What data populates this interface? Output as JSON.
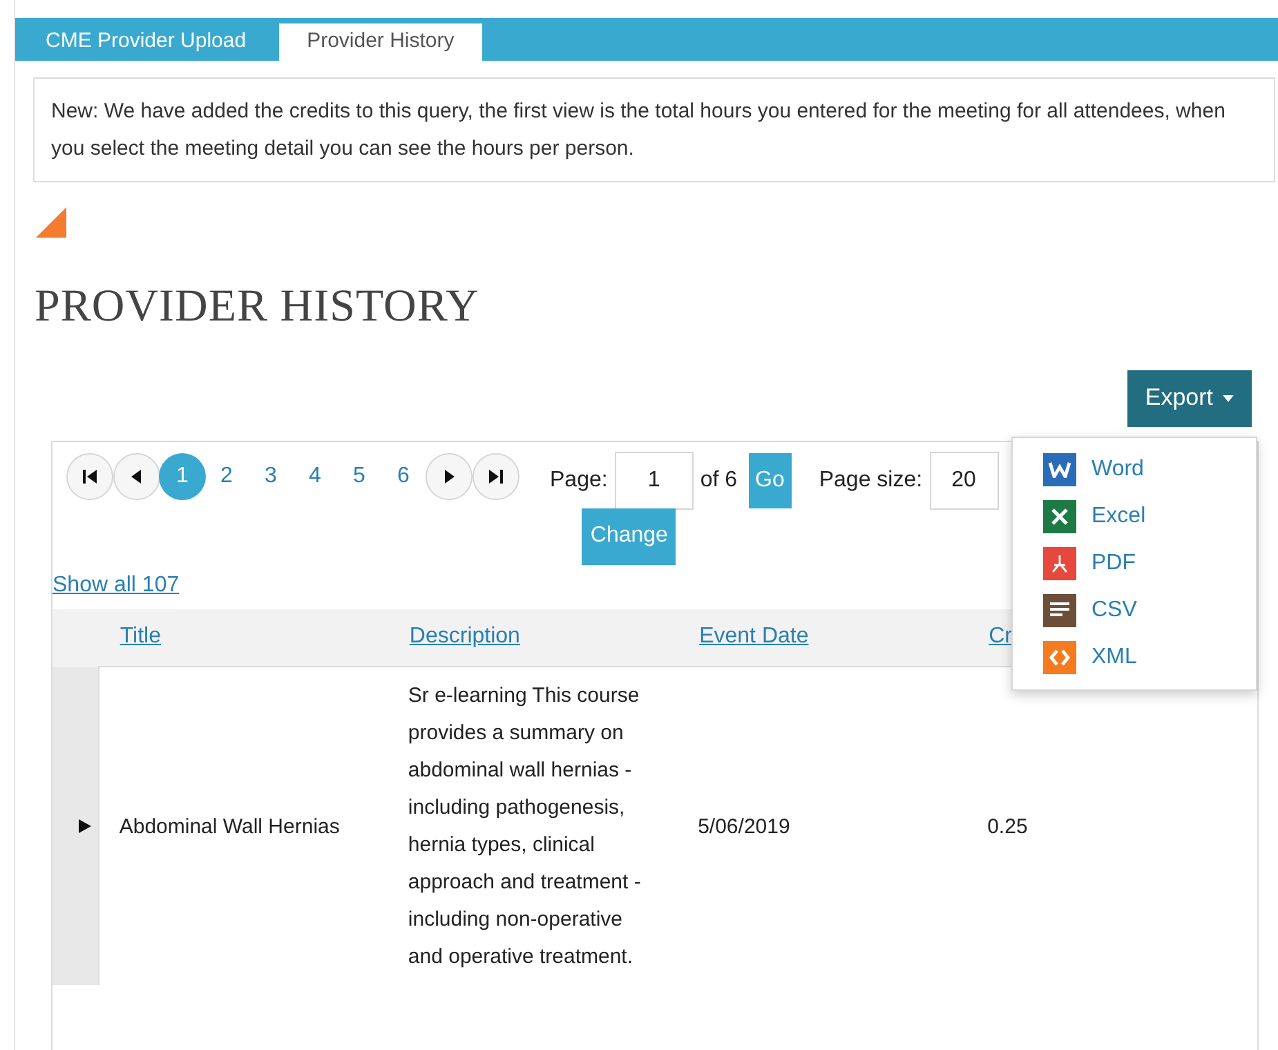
{
  "tabs": [
    {
      "label": "CME Provider Upload",
      "selected": false
    },
    {
      "label": "Provider History",
      "selected": true
    }
  ],
  "notice": "New: We have added the credits to this query, the first view is the total hours you entered for the meeting for all attendees, when you select the meeting detail you can see the hours per person.",
  "heading": "PROVIDER HISTORY",
  "export": {
    "label": "Export",
    "expanded": true,
    "items": [
      {
        "kind": "word",
        "label": "Word"
      },
      {
        "kind": "excel",
        "label": "Excel"
      },
      {
        "kind": "pdf",
        "label": "PDF"
      },
      {
        "kind": "csv",
        "label": "CSV"
      },
      {
        "kind": "xml",
        "label": "XML"
      }
    ]
  },
  "pager": {
    "pages": [
      {
        "label": "1",
        "selected": true
      },
      {
        "label": "2",
        "selected": false
      },
      {
        "label": "3",
        "selected": false
      },
      {
        "label": "4",
        "selected": false
      },
      {
        "label": "5",
        "selected": false
      },
      {
        "label": "6",
        "selected": false
      }
    ],
    "page_label": "Page:",
    "page_value": "1",
    "of": "of 6",
    "go": "Go",
    "size_label": "Page size:",
    "size_value": "20",
    "change": "Change"
  },
  "show_all": "Show all 107",
  "table": {
    "columns": [
      "Title",
      "Description",
      "Event Date",
      "Cr"
    ],
    "rows": [
      {
        "expanded": false,
        "cells": [
          "Abdominal Wall Hernias",
          "Sr e-learning This course provides a summary on abdominal wall hernias - including pathogenesis, hernia types, clinical approach and treatment - including non-operative and operative treatment.",
          "5/06/2019",
          "0.25"
        ]
      }
    ]
  }
}
